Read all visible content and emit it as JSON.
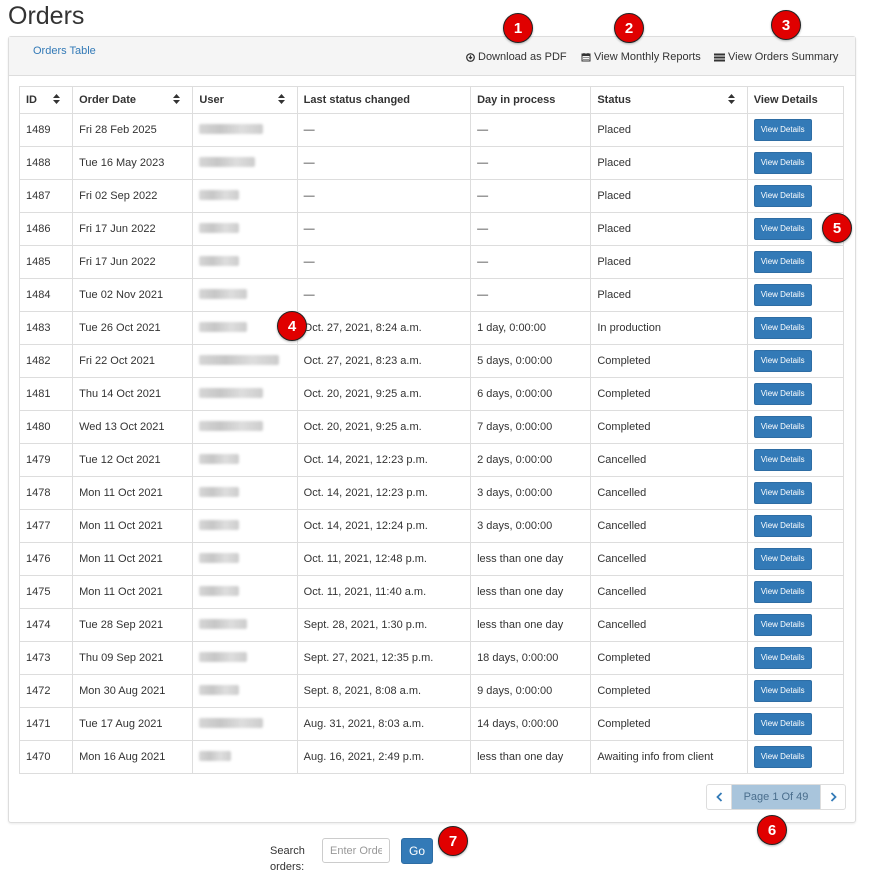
{
  "page": {
    "title": "Orders"
  },
  "panel": {
    "tab_label": "Orders Table",
    "actions": {
      "download_pdf": "Download as PDF",
      "monthly_reports": "View Monthly Reports",
      "orders_summary": "View Orders Summary"
    }
  },
  "table": {
    "headers": [
      "ID",
      "Order Date",
      "User",
      "Last status changed",
      "Day in process",
      "Status",
      "View Details"
    ],
    "view_button_label": "View Details",
    "rows": [
      {
        "id": "1489",
        "date": "Fri 28 Feb 2025",
        "last_changed": "—",
        "days": "—",
        "status": "Placed"
      },
      {
        "id": "1488",
        "date": "Tue 16 May 2023",
        "last_changed": "—",
        "days": "—",
        "status": "Placed"
      },
      {
        "id": "1487",
        "date": "Fri 02 Sep 2022",
        "last_changed": "—",
        "days": "—",
        "status": "Placed"
      },
      {
        "id": "1486",
        "date": "Fri 17 Jun 2022",
        "last_changed": "—",
        "days": "—",
        "status": "Placed"
      },
      {
        "id": "1485",
        "date": "Fri 17 Jun 2022",
        "last_changed": "—",
        "days": "—",
        "status": "Placed"
      },
      {
        "id": "1484",
        "date": "Tue 02 Nov 2021",
        "last_changed": "—",
        "days": "—",
        "status": "Placed"
      },
      {
        "id": "1483",
        "date": "Tue 26 Oct 2021",
        "last_changed": "Oct. 27, 2021, 8:24 a.m.",
        "days": "1 day, 0:00:00",
        "status": "In production"
      },
      {
        "id": "1482",
        "date": "Fri 22 Oct 2021",
        "last_changed": "Oct. 27, 2021, 8:23 a.m.",
        "days": "5 days, 0:00:00",
        "status": "Completed"
      },
      {
        "id": "1481",
        "date": "Thu 14 Oct 2021",
        "last_changed": "Oct. 20, 2021, 9:25 a.m.",
        "days": "6 days, 0:00:00",
        "status": "Completed"
      },
      {
        "id": "1480",
        "date": "Wed 13 Oct 2021",
        "last_changed": "Oct. 20, 2021, 9:25 a.m.",
        "days": "7 days, 0:00:00",
        "status": "Completed"
      },
      {
        "id": "1479",
        "date": "Tue 12 Oct 2021",
        "last_changed": "Oct. 14, 2021, 12:23 p.m.",
        "days": "2 days, 0:00:00",
        "status": "Cancelled"
      },
      {
        "id": "1478",
        "date": "Mon 11 Oct 2021",
        "last_changed": "Oct. 14, 2021, 12:23 p.m.",
        "days": "3 days, 0:00:00",
        "status": "Cancelled"
      },
      {
        "id": "1477",
        "date": "Mon 11 Oct 2021",
        "last_changed": "Oct. 14, 2021, 12:24 p.m.",
        "days": "3 days, 0:00:00",
        "status": "Cancelled"
      },
      {
        "id": "1476",
        "date": "Mon 11 Oct 2021",
        "last_changed": "Oct. 11, 2021, 12:48 p.m.",
        "days": "less than one day",
        "status": "Cancelled"
      },
      {
        "id": "1475",
        "date": "Mon 11 Oct 2021",
        "last_changed": "Oct. 11, 2021, 11:40 a.m.",
        "days": "less than one day",
        "status": "Cancelled"
      },
      {
        "id": "1474",
        "date": "Tue 28 Sep 2021",
        "last_changed": "Sept. 28, 2021, 1:30 p.m.",
        "days": "less than one day",
        "status": "Cancelled"
      },
      {
        "id": "1473",
        "date": "Thu 09 Sep 2021",
        "last_changed": "Sept. 27, 2021, 12:35 p.m.",
        "days": "18 days, 0:00:00",
        "status": "Completed"
      },
      {
        "id": "1472",
        "date": "Mon 30 Aug 2021",
        "last_changed": "Sept. 8, 2021, 8:08 a.m.",
        "days": "9 days, 0:00:00",
        "status": "Completed"
      },
      {
        "id": "1471",
        "date": "Tue 17 Aug 2021",
        "last_changed": "Aug. 31, 2021, 8:03 a.m.",
        "days": "14 days, 0:00:00",
        "status": "Completed"
      },
      {
        "id": "1470",
        "date": "Mon 16 Aug 2021",
        "last_changed": "Aug. 16, 2021, 2:49 p.m.",
        "days": "less than one day",
        "status": "Awaiting info from client"
      }
    ]
  },
  "pagination": {
    "label": "Page 1 Of 49"
  },
  "search": {
    "label": "Search orders:",
    "placeholder": "Enter Order ID",
    "go_label": "Go"
  },
  "markers": [
    "1",
    "2",
    "3",
    "4",
    "5",
    "6",
    "7"
  ],
  "colors": {
    "primary": "#337ab7",
    "marker": "#e00000",
    "pager_active": "#a9c5dc"
  }
}
